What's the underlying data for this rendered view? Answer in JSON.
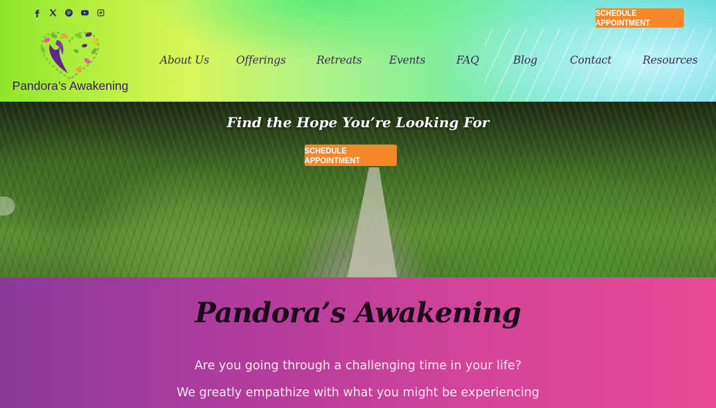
{
  "header": {
    "social": [
      {
        "name": "facebook-icon",
        "glyph": "f"
      },
      {
        "name": "x-twitter-icon",
        "glyph": "X"
      },
      {
        "name": "pinterest-icon",
        "glyph": "P"
      },
      {
        "name": "youtube-icon",
        "glyph": "▶"
      },
      {
        "name": "instagram-icon",
        "glyph": "◎"
      }
    ],
    "cta_label": "SCHEDULE APPOINTMENT",
    "logo_text": "Pandora’s Awakening",
    "nav": [
      "About Us",
      "Offerings",
      "Retreats",
      "Events",
      "FAQ",
      "Blog",
      "Contact",
      "Resources"
    ]
  },
  "hero": {
    "title": "Find the Hope You’re Looking For",
    "cta_label": "SCHEDULE APPOINTMENT"
  },
  "intro": {
    "title": "Pandora’s Awakening",
    "line1": "Are you going through a challenging time in your life?",
    "line2": "We greatly empathize with what you might be experiencing"
  },
  "colors": {
    "accent_orange": "#f6872a",
    "brand_purple": "#3a1a5c",
    "section_pink": "#d24499"
  }
}
